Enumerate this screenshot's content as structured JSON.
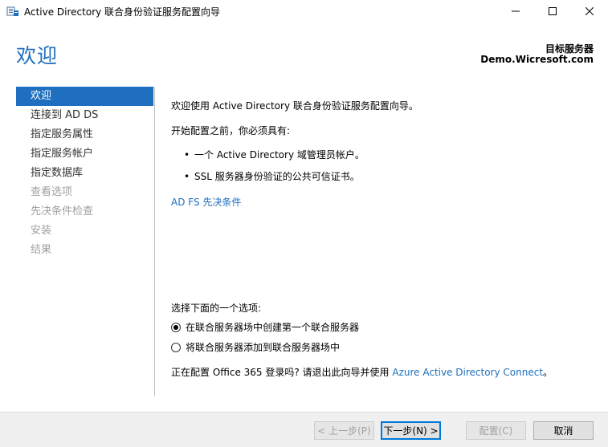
{
  "window": {
    "title": "Active Directory 联合身份验证服务配置向导"
  },
  "header": {
    "heading": "欢迎",
    "server_label": "目标服务器",
    "server_name": "Demo.Wicresoft.com"
  },
  "nav": {
    "items": [
      {
        "label": "欢迎",
        "state": "active"
      },
      {
        "label": "连接到 AD DS",
        "state": "enabled"
      },
      {
        "label": "指定服务属性",
        "state": "enabled"
      },
      {
        "label": "指定服务帐户",
        "state": "enabled"
      },
      {
        "label": "指定数据库",
        "state": "enabled"
      },
      {
        "label": "查看选项",
        "state": "disabled"
      },
      {
        "label": "先决条件检查",
        "state": "disabled"
      },
      {
        "label": "安装",
        "state": "disabled"
      },
      {
        "label": "结果",
        "state": "disabled"
      }
    ]
  },
  "content": {
    "intro": "欢迎使用 Active Directory 联合身份验证服务配置向导。",
    "before_config": "开始配置之前，你必须具有:",
    "requirements": [
      "一个 Active Directory 域管理员帐户。",
      "SSL 服务器身份验证的公共可信证书。"
    ],
    "prereq_link": "AD FS 先决条件",
    "choose_option": "选择下面的一个选项:",
    "options": [
      {
        "label": "在联合服务器场中创建第一个联合服务器",
        "selected": true
      },
      {
        "label": "将联合服务器添加到联合服务器场中",
        "selected": false
      }
    ],
    "office_text": "正在配置 Office 365 登录吗? 请退出此向导并使用 ",
    "office_link": "Azure Active Directory Connect",
    "office_suffix": "。"
  },
  "buttons": {
    "previous": "< 上一步(P)",
    "next": "下一步(N) >",
    "configure": "配置(C)",
    "cancel": "取消"
  },
  "colors": {
    "accent": "#1e6fbf",
    "disabled_text": "#a0a0a0"
  }
}
